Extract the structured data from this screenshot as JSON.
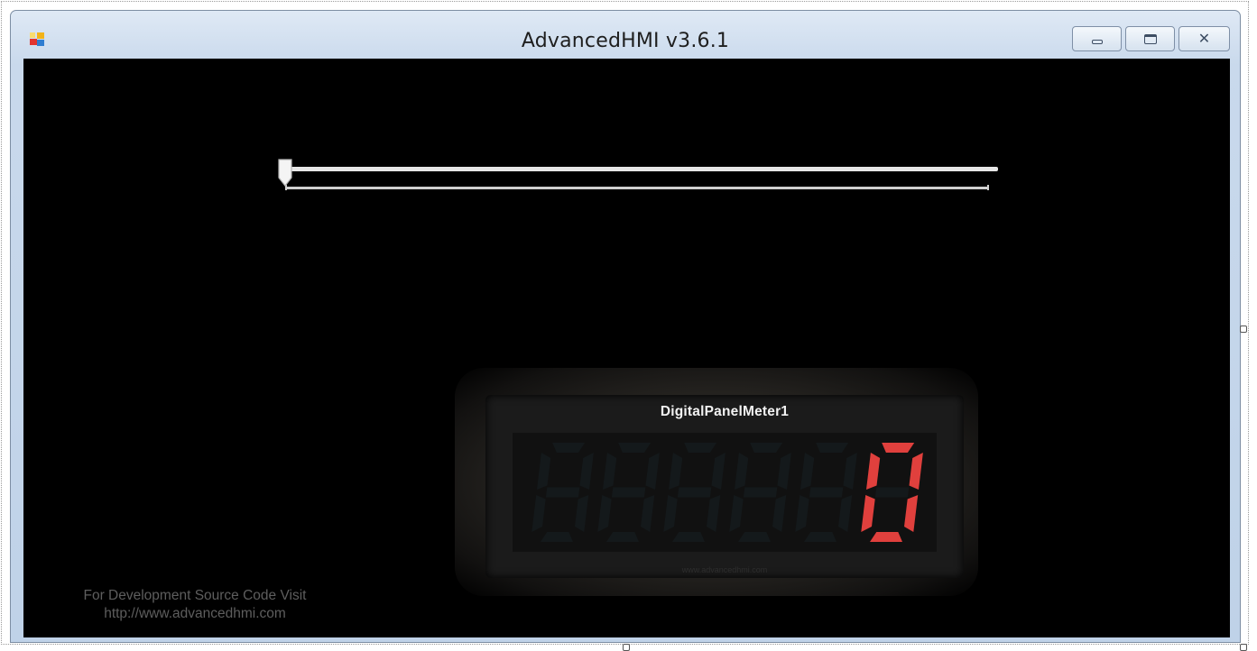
{
  "window": {
    "title": "AdvancedHMI v3.6.1",
    "controls": [
      "minimize-icon",
      "maximize-icon",
      "close-icon"
    ],
    "close_glyph": "✕"
  },
  "slider": {
    "value": 0,
    "fraction": 0.0
  },
  "meter": {
    "title": "DigitalPanelMeter1",
    "value": "0",
    "digit_count": 6,
    "url_watermark": "www.advancedhmi.com",
    "active_color": "#e0403d",
    "inactive_color": "#14191b"
  },
  "footer": {
    "line1": "For Development Source Code Visit",
    "line2": "http://www.advancedhmi.com"
  },
  "colors": {
    "client_background": "#000000",
    "titlebar": "#c9d9ec"
  }
}
